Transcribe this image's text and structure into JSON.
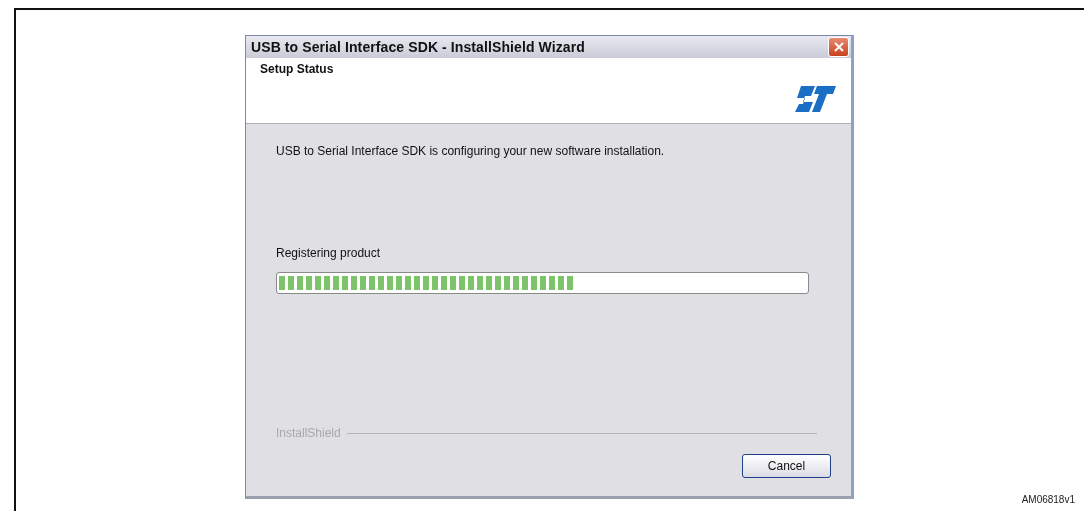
{
  "window": {
    "title": "USB to Serial Interface SDK - InstallShield Wizard"
  },
  "header": {
    "title": "Setup Status"
  },
  "body": {
    "message": "USB to Serial Interface SDK is configuring your new software installation.",
    "status": "Registering product",
    "progress": {
      "level": 0.56
    }
  },
  "footer": {
    "brand": "InstallShield",
    "buttons": [
      "Cancel"
    ]
  },
  "figure_id": "AM06818v1"
}
